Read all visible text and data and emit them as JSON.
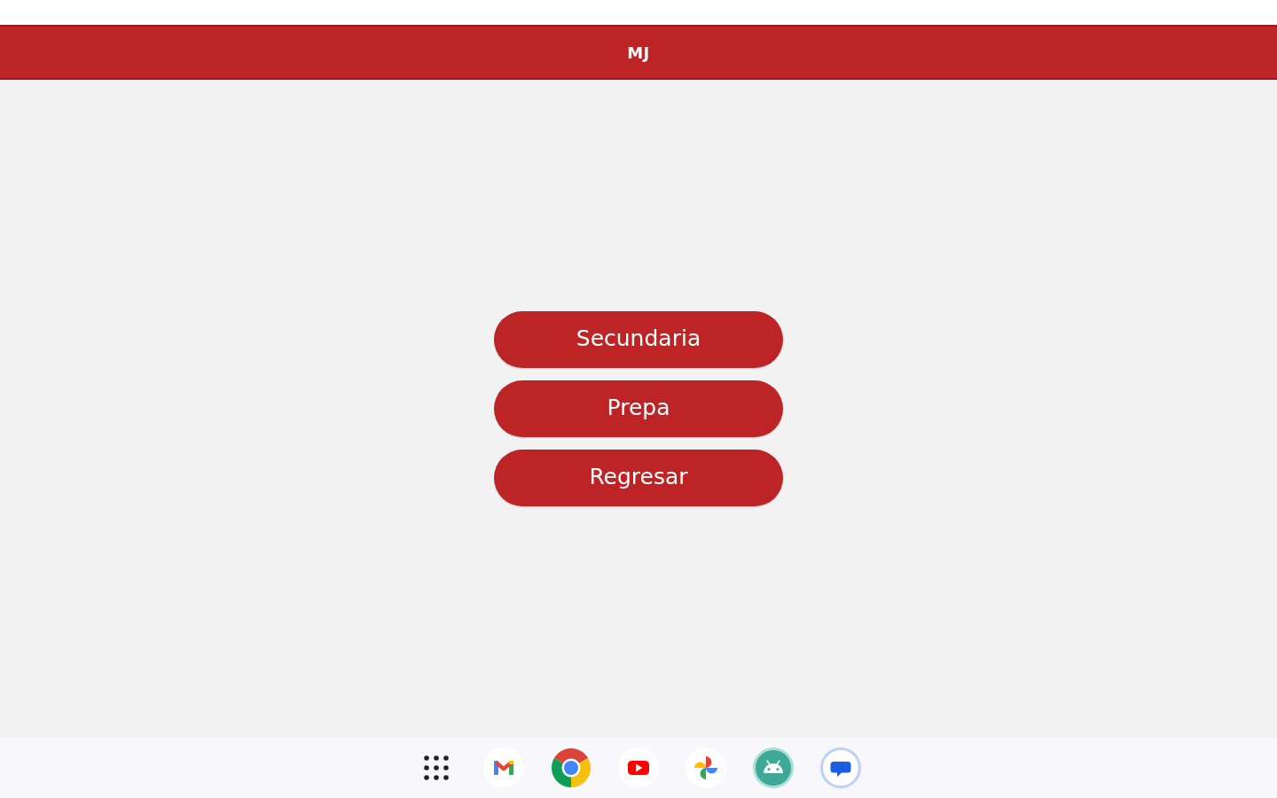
{
  "header": {
    "title": "MJ"
  },
  "menu": {
    "buttons": [
      "Secundaria",
      "Prepa",
      "Regresar"
    ]
  }
}
